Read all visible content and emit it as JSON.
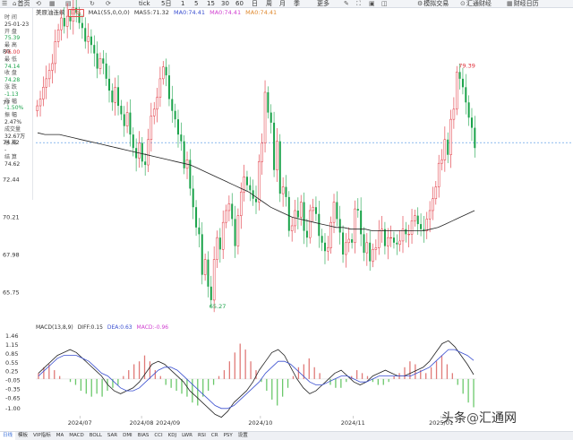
{
  "toolbar": {
    "home": "首页",
    "tick": "tick",
    "periods": [
      "5日",
      "1",
      "5",
      "15",
      "30",
      "60",
      "日",
      "周",
      "月",
      "季",
      "更多"
    ],
    "sim_trade": "模拟交易",
    "huitong": "汇通财经",
    "calendar": "财经日历"
  },
  "legend": {
    "symbol": "美原油连续",
    "period": "日线",
    "ma1": "MA1(55,0,0,0)",
    "ma55": "MA55:71.32",
    "ma0a": "MA0:74.41",
    "ma0b": "MA0:74.41",
    "ma0c": "MA0:74.41"
  },
  "info": {
    "time_label": "时 间",
    "time_value": "25-01-23",
    "open_label": "开 盘",
    "open_value": "75.39",
    "high_label": "最 高",
    "high_value": "76.00",
    "low_label": "最 低",
    "low_value": "74.14",
    "close_label": "收 盘",
    "close_value": "74.28",
    "change_label": "涨 跌",
    "change_value": "-1.13",
    "pct_label": "涨 幅",
    "pct_value": "-1.50%",
    "amp_label": "振 幅",
    "amp_value": "2.47%",
    "vol_label": "成交量",
    "vol_value": "32.67万",
    "oi_label": "总 持",
    "oi_value": "-",
    "settle_label": "结 算",
    "settle_value": "74.62"
  },
  "macd_legend": {
    "name": "MACD(13,8,9)",
    "diff": "DIFF:0.15",
    "dea": "DEA:0.63",
    "macd": "MACD:-0.96"
  },
  "tabs": [
    "日线",
    "模板",
    "VIP指标",
    "MA",
    "MACD",
    "BOLL",
    "SAR",
    "DMI",
    "BIAS",
    "CCI",
    "KDJ",
    "LWR",
    "RSI",
    "CR",
    "PSY",
    "设置"
  ],
  "watermark": {
    "text1": "头条",
    "at": "@",
    "text2": "汇通网"
  },
  "colors": {
    "up": "#e0303a",
    "down": "#1aa34a",
    "ma55": "#222222",
    "dea": "#3a4fd0",
    "macd_up": "#e07a78",
    "macd_down": "#6bc86b",
    "price_line": "#4a90e2"
  },
  "chart_data": [
    {
      "type": "candlestick",
      "title": "美原油连续 日线",
      "x_ticks": [
        "2024/07",
        "2024/08",
        "2024/09",
        "2024/10",
        "2024/11",
        "2025/01"
      ],
      "y_ticks": [
        "80",
        "77",
        "74.62",
        "72.44",
        "70.21",
        "67.98",
        "65.75"
      ],
      "ylim": [
        64.5,
        82
      ],
      "annotations": [
        {
          "label": "79.39",
          "kind": "high"
        },
        {
          "label": "65.27",
          "kind": "low"
        }
      ],
      "current_price": 74.62,
      "closes": [
        76.8,
        77.2,
        77.9,
        78.4,
        78.9,
        79.3,
        80.6,
        81.3,
        82.0,
        81.5,
        82.1,
        81.8,
        82.6,
        82.3,
        81.7,
        81.4,
        80.6,
        80.9,
        80.4,
        79.9,
        79.0,
        79.6,
        79.3,
        78.4,
        77.7,
        77.0,
        77.9,
        76.8,
        76.3,
        75.6,
        76.4,
        75.1,
        74.3,
        73.7,
        74.6,
        73.5,
        73.3,
        74.8,
        76.2,
        76.6,
        77.3,
        78.4,
        79.1,
        78.6,
        77.2,
        76.5,
        76.0,
        75.1,
        74.7,
        73.1,
        73.6,
        71.9,
        70.8,
        69.6,
        69.2,
        66.8,
        67.7,
        66.1,
        65.3,
        67.7,
        69.0,
        68.3,
        69.9,
        70.6,
        71.0,
        70.1,
        68.5,
        70.3,
        71.7,
        72.6,
        72.1,
        71.8,
        71.3,
        71.1,
        73.5,
        74.6,
        77.6,
        76.4,
        75.8,
        73.0,
        74.7,
        71.6,
        72.0,
        71.4,
        69.4,
        69.7,
        70.6,
        70.2,
        71.1,
        69.4,
        69.0,
        70.6,
        70.8,
        70.4,
        69.1,
        68.7,
        68.2,
        68.4,
        69.9,
        71.1,
        70.1,
        69.3,
        68.0,
        68.7,
        68.9,
        68.7,
        70.7,
        70.6,
        69.2,
        68.1,
        68.7,
        67.6,
        68.3,
        68.4,
        69.4,
        69.5,
        68.5,
        69.0,
        69.0,
        68.7,
        68.6,
        68.8,
        69.5,
        69.2,
        69.2,
        70.0,
        70.3,
        69.8,
        69.5,
        69.4,
        70.1,
        70.6,
        71.3,
        72.0,
        73.4,
        73.6,
        74.8,
        73.9,
        76.0,
        76.6,
        78.8,
        78.4,
        77.9,
        77.0,
        76.1,
        75.5,
        74.3
      ],
      "ma55": [
        75.2,
        75.1,
        75.1,
        75.1,
        75.0,
        74.9,
        74.8,
        74.7,
        74.6,
        74.5,
        74.4,
        74.3,
        74.2,
        74.1,
        74.0,
        73.9,
        73.8,
        73.7,
        73.6,
        73.5,
        73.4,
        73.3,
        73.1,
        72.9,
        72.7,
        72.5,
        72.3,
        72.1,
        71.9,
        71.7,
        71.4,
        71.1,
        70.8,
        70.6,
        70.4,
        70.2,
        70.1,
        70.0,
        69.9,
        69.8,
        69.7,
        69.6,
        69.6,
        69.5,
        69.5,
        69.5,
        69.4,
        69.4,
        69.4,
        69.4,
        69.4,
        69.4,
        69.4,
        69.4,
        69.5,
        69.6,
        69.8,
        70.0,
        70.2,
        70.4,
        70.6
      ],
      "macd_hist": [
        0.2,
        0.4,
        0.5,
        0.3,
        0.1,
        0.0,
        -0.1,
        -0.2,
        -0.4,
        -0.5,
        -0.6,
        -0.5,
        -0.6,
        -0.4,
        -0.3,
        -0.2,
        0.1,
        0.3,
        0.5,
        0.6,
        0.8,
        0.6,
        0.3,
        0.1,
        -0.2,
        -0.3,
        -0.4,
        -0.5,
        -0.6,
        -0.8,
        -0.9,
        -0.6,
        -0.4,
        -0.2,
        0.1,
        0.3,
        0.6,
        0.9,
        1.2,
        1.0,
        0.6,
        0.3,
        -0.1,
        -0.4,
        -0.7,
        -0.9,
        -0.6,
        -0.3,
        0.1,
        0.4,
        0.5,
        0.7,
        0.4,
        0.2,
        0.0,
        -0.2,
        -0.3,
        -0.3,
        -0.1,
        0.1,
        0.3,
        0.2,
        0.1,
        -0.1,
        -0.2,
        -0.2,
        -0.1,
        0.1,
        0.2,
        0.4,
        0.6,
        0.5,
        0.3,
        0.2,
        0.4,
        0.6,
        0.8,
        0.5,
        0.2,
        -0.2,
        -0.5,
        -0.8,
        -0.96
      ],
      "diff": [
        0.2,
        0.4,
        0.6,
        0.8,
        0.9,
        1.0,
        0.9,
        0.7,
        0.5,
        0.3,
        0.1,
        -0.2,
        -0.4,
        -0.5,
        -0.4,
        -0.3,
        -0.1,
        0.2,
        0.5,
        0.6,
        0.5,
        0.3,
        0.1,
        -0.1,
        -0.4,
        -0.6,
        -0.8,
        -1.0,
        -1.2,
        -1.3,
        -1.1,
        -0.8,
        -0.6,
        -0.4,
        -0.1,
        0.3,
        0.6,
        0.9,
        1.0,
        0.8,
        0.4,
        0.0,
        -0.3,
        -0.5,
        -0.4,
        -0.2,
        0.0,
        0.2,
        0.3,
        0.1,
        -0.1,
        -0.2,
        -0.1,
        0.1,
        0.2,
        0.3,
        0.2,
        0.1,
        0.1,
        0.2,
        0.3,
        0.4,
        0.6,
        0.9,
        1.2,
        1.3,
        1.1,
        0.8,
        0.5,
        0.15
      ],
      "dea": [
        0.1,
        0.3,
        0.5,
        0.7,
        0.8,
        0.8,
        0.8,
        0.7,
        0.6,
        0.4,
        0.2,
        0.1,
        -0.1,
        -0.3,
        -0.4,
        -0.4,
        -0.3,
        -0.1,
        0.1,
        0.3,
        0.4,
        0.4,
        0.3,
        0.1,
        -0.1,
        -0.3,
        -0.5,
        -0.7,
        -0.9,
        -1.0,
        -1.0,
        -0.9,
        -0.7,
        -0.5,
        -0.3,
        -0.1,
        0.2,
        0.4,
        0.6,
        0.6,
        0.5,
        0.3,
        0.1,
        -0.1,
        -0.2,
        -0.2,
        -0.1,
        0.0,
        0.1,
        0.1,
        0.0,
        -0.1,
        -0.1,
        0.0,
        0.1,
        0.1,
        0.1,
        0.1,
        0.1,
        0.1,
        0.2,
        0.3,
        0.4,
        0.6,
        0.8,
        1.0,
        1.0,
        0.9,
        0.8,
        0.63
      ],
      "macd_yticks": [
        "1.46",
        "1.15",
        "0.85",
        "0.55",
        "0.25",
        "-0.05",
        "-0.35",
        "-0.65",
        "-1.00"
      ],
      "macd_ylim": [
        -1.25,
        1.55
      ]
    }
  ]
}
